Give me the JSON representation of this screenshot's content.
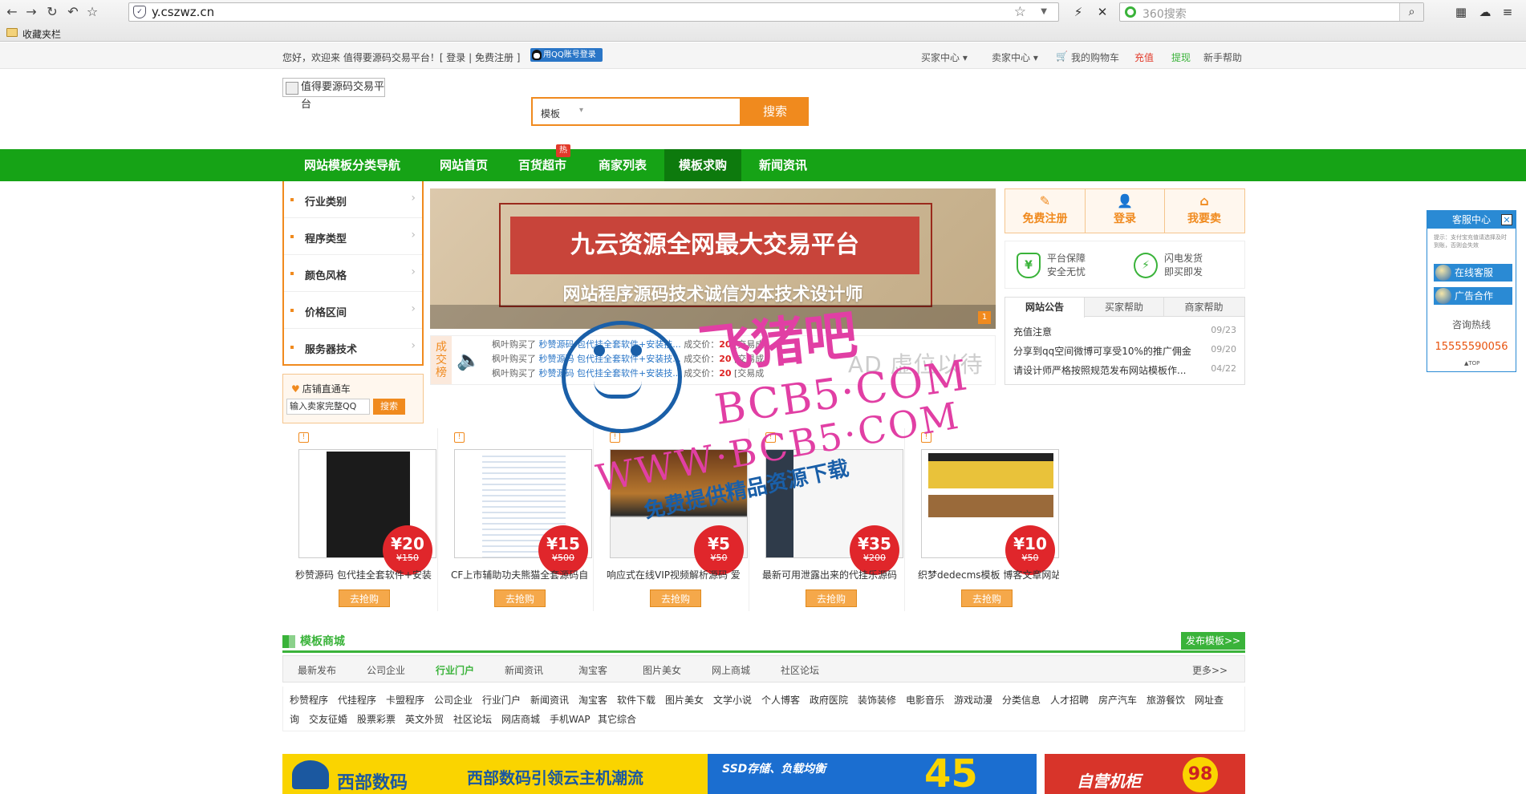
{
  "browser": {
    "url": "y.cszwz.cn",
    "search_placeholder": "360搜索",
    "favorites_label": "收藏夹栏"
  },
  "topbar": {
    "welcome": "您好，欢迎来 值得要源码交易平台！[ 登录 | 免费注册 ]",
    "qq_login": "用QQ账号登录",
    "links": [
      "买家中心 ▾",
      "卖家中心 ▾",
      "我的购物车",
      "充值",
      "提现",
      "新手帮助"
    ],
    "link_colors": {
      "recharge": "#e23a2a",
      "withdraw": "#3ab33a"
    }
  },
  "header": {
    "logo_alt": "值得要源码交易平台",
    "search_category": "模板",
    "search_button": "搜索"
  },
  "nav": {
    "items": [
      "网站模板分类导航",
      "网站首页",
      "百货超市",
      "商家列表",
      "模板求购",
      "新闻资讯"
    ],
    "active_index": 4,
    "hot_badge": "热",
    "color": "#16a316"
  },
  "categories": [
    "行业类别",
    "程序类型",
    "颜色风格",
    "价格区间",
    "服务器技术"
  ],
  "shop_direct": {
    "title": "店铺直通车",
    "input_value": "输入卖家完整QQ",
    "button": "搜索"
  },
  "banner": {
    "headline": "九云资源全网最大交易平台",
    "subline": "网站程序源码技术诚信为本技术设计师",
    "slide_number": "1"
  },
  "ticker": {
    "label": "成交榜",
    "rows": [
      {
        "buyer": "枫叶购买了",
        "item": "秒赞源码 包代挂全套软件+安装技...",
        "deal": "成交价",
        "price": "20",
        "note": "[交易成"
      },
      {
        "buyer": "枫叶购买了",
        "item": "秒赞源码 包代挂全套软件+安装技...",
        "deal": "成交价",
        "price": "20",
        "note": "[交易成"
      },
      {
        "buyer": "枫叶购买了",
        "item": "秒赞源码 包代挂全套软件+安装技...",
        "deal": "成交价",
        "price": "20",
        "note": "[交易成"
      }
    ],
    "ad_text": "AD 虚位以待"
  },
  "right_panel": {
    "buttons": [
      {
        "label": "免费注册",
        "icon": "edit-icon"
      },
      {
        "label": "登录",
        "icon": "user-icon"
      },
      {
        "label": "我要卖",
        "icon": "shop-icon"
      }
    ],
    "guarantees": [
      {
        "line1": "平台保障",
        "line2": "安全无忧"
      },
      {
        "line1": "闪电发货",
        "line2": "即买即发"
      }
    ],
    "notice_tabs": [
      "网站公告",
      "买家帮助",
      "商家帮助"
    ],
    "notices": [
      {
        "title": "充值注意",
        "date": "09/23"
      },
      {
        "title": "分享到qq空间微博可享受10%的推广佣金",
        "date": "09/20"
      },
      {
        "title": "请设计师严格按照规范发布网站模板作...",
        "date": "04/22"
      }
    ]
  },
  "service_widget": {
    "title": "客服中心",
    "tip": "提示：支付宝充值请选择及时到账，否则会失效",
    "online": "在线客服",
    "ads": "广告合作",
    "hotline_label": "咨询热线",
    "phone": "15555590056",
    "top": "▲TOP"
  },
  "products": [
    {
      "name": "秒赞源码 包代挂全套软件+安装",
      "price": "¥20",
      "original": "¥150",
      "buy": "去抢购"
    },
    {
      "name": "CF上市辅助功夫熊猫全套源码自",
      "price": "¥15",
      "original": "¥500",
      "buy": "去抢购"
    },
    {
      "name": "响应式在线VIP视频解析源码 爱",
      "price": "¥5",
      "original": "¥50",
      "buy": "去抢购"
    },
    {
      "name": "最新可用泄露出来的代挂乐源码",
      "price": "¥35",
      "original": "¥200",
      "buy": "去抢购"
    },
    {
      "name": "织梦dedecms模板 博客文章网站",
      "price": "¥10",
      "original": "¥50",
      "buy": "去抢购"
    }
  ],
  "mall": {
    "title": "模板商城",
    "publish": "发布模板>>",
    "tabs": [
      "最新发布",
      "公司企业",
      "行业门户",
      "新闻资讯",
      "淘宝客",
      "图片美女",
      "网上商城",
      "社区论坛"
    ],
    "active_tab": 2,
    "more": "更多>>",
    "links_row1": [
      "秒赞程序",
      "代挂程序",
      "卡盟程序",
      "公司企业",
      "行业门户",
      "新闻资讯",
      "淘宝客",
      "软件下载",
      "图片美女",
      "文学小说",
      "个人博客",
      "政府医院",
      "装饰装修",
      "电影音乐",
      "游戏动漫",
      "分类信息",
      "人才招聘",
      "房产汽车",
      "旅游餐饮",
      "网址查"
    ],
    "links_row2": [
      "询",
      "交友征婚",
      "股票彩票",
      "英文外贸",
      "社区论坛",
      "网店商城",
      "手机WAP",
      "其它综合"
    ]
  },
  "ads": {
    "west_brand": "西部数码",
    "west_slogan": "西部数码引领云主机潮流",
    "west_ssd": "SSD存储、负载均衡",
    "west_big": "45",
    "php_title": "自营机柜",
    "php_num": "98"
  },
  "watermark": {
    "cn": "飞猪吧",
    "url": "BCB5·COM",
    "www": "WWW·BCB5·COM",
    "tagline": "免费提供精品资源下载"
  }
}
